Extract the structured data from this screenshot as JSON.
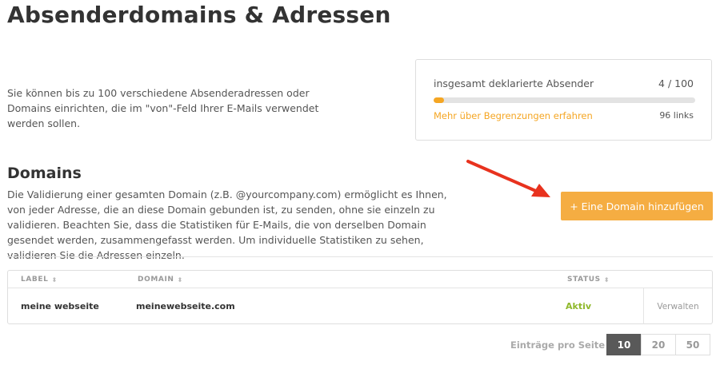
{
  "page": {
    "title": "Absenderdomains & Adressen",
    "intro": "Sie können bis zu 100 verschiedene Absenderadressen oder Domains einrichten, die im \"von\"-Feld Ihrer E-Mails verwendet werden sollen."
  },
  "quota": {
    "label": "insgesamt deklarierte Absender",
    "count": "4 / 100",
    "used": 4,
    "max": 100,
    "link": "Mehr über Begrenzungen erfahren",
    "remaining": "96 links"
  },
  "domains": {
    "heading": "Domains",
    "description": "Die Validierung einer gesamten Domain (z.B. @yourcompany.com) ermöglicht es Ihnen, von jeder Adresse, die an diese Domain gebunden ist, zu senden, ohne sie einzeln zu validieren. Beachten Sie, dass die Statistiken für E-Mails, die von derselben Domain gesendet werden, zusammengefasst werden. Um individuelle Statistiken zu sehen, validieren Sie die Adressen einzeln.",
    "add_button": "+ Eine Domain hinzufügen"
  },
  "table": {
    "columns": [
      "LABEL",
      "DOMAIN",
      "STATUS"
    ],
    "rows": [
      {
        "label": "meine webseite",
        "domain": "meinewebseite.com",
        "status": "Aktiv",
        "action": "Verwalten"
      }
    ]
  },
  "pagination": {
    "label": "Einträge pro Seite",
    "options": [
      "10",
      "20",
      "50"
    ],
    "selected": "10"
  },
  "colors": {
    "accent": "#f5a623",
    "button": "#f5ad42",
    "status_active": "#8fb82b",
    "arrow": "#e8321e"
  },
  "icons": {
    "sort": "sort-icon",
    "arrow": "red-arrow-icon"
  }
}
